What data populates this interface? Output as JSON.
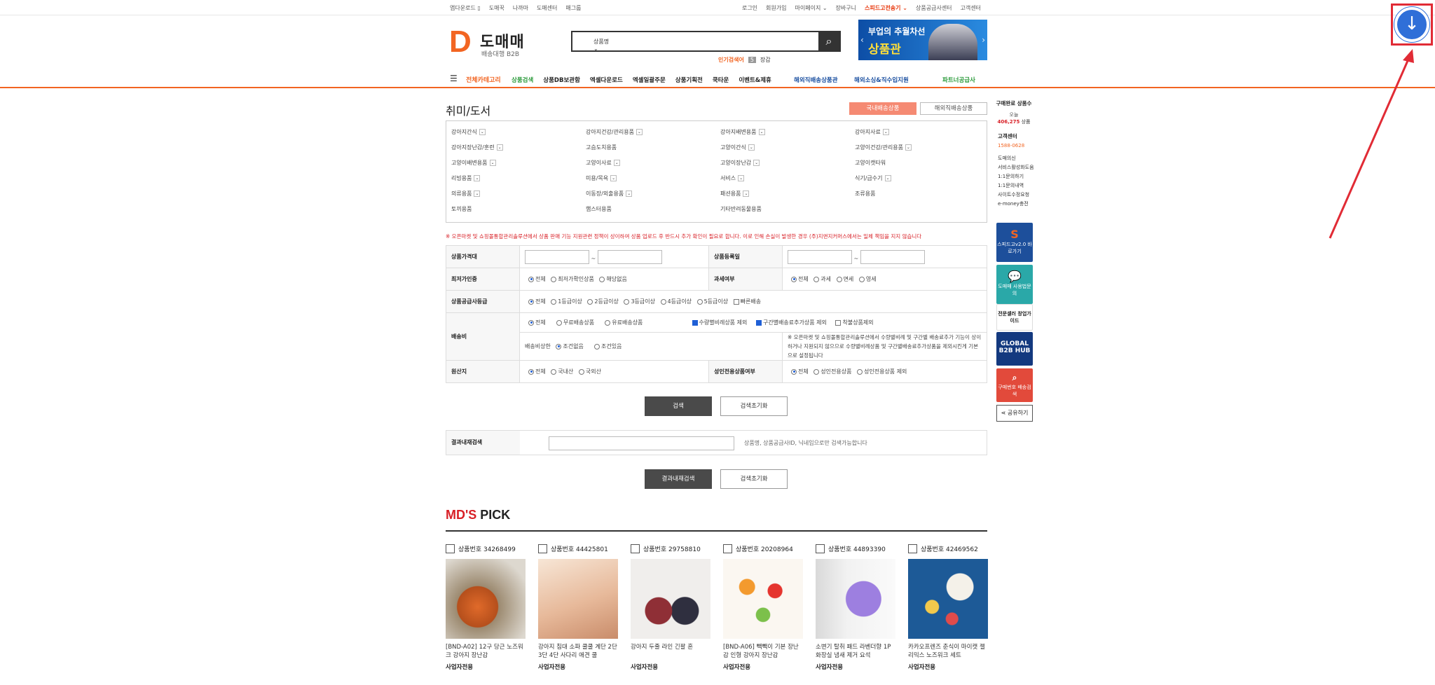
{
  "util_left": [
    "앱다운로드 ▯",
    "도매꾹",
    "나까마",
    "도매센터",
    "매그룹"
  ],
  "util_right": [
    "로그인",
    "회원가입",
    "마이페이지 ⌄",
    "장바구니",
    "스피드고전송기 ⌄",
    "상품공급사센터",
    "고객센터"
  ],
  "logo": {
    "mark": "D",
    "name": "도매매",
    "sub": "배송대행 B2B"
  },
  "search": {
    "category": "상품명",
    "placeholder": ""
  },
  "popular": {
    "label": "인기검색어",
    "rank": "5",
    "term": "장갑"
  },
  "banner": {
    "line1": "부업의 추월차선",
    "line2": "상품관"
  },
  "nav": {
    "all": "전체카테고리",
    "items": [
      "상품검색",
      "상품DB보관함",
      "엑셀다운로드",
      "엑셀일괄주문",
      "상품기획전",
      "쿡타운",
      "이벤트&제휴"
    ],
    "overseas1": "해외직배송상품관",
    "overseas2": "해외소싱&직수입지원",
    "partner": "파트너공급사"
  },
  "page_title": "취미/도서",
  "tabs": {
    "domestic": "국내배송상품",
    "overseas": "해외직배송상품"
  },
  "categories": [
    "강아지간식",
    "강아지건강/관리용품",
    "강아지배변용품",
    "강아지사료",
    "강아지장난감/훈련",
    "고슴도치용품",
    "고양이간식",
    "고양이건강/관리용품",
    "고양이배변용품",
    "고양이사료",
    "고양이장난감",
    "고양이캣타워",
    "리빙용품",
    "미용/목욕",
    "서비스",
    "식기/급수기",
    "의류용품",
    "이동장/외출용품",
    "패션용품",
    "조류용품",
    "토끼용품",
    "햄스터용품",
    "기타반려동물용품",
    ""
  ],
  "notice": "※ 오픈마켓 및 쇼핑몰통합관리솔루션에서 상품 판매 기능 지원관련 정책이 상이하여 상품 업로드 후 반드시 추가 확인이 필요로 합니다. 이로 인해 손실이 발생한 경우 (주)지앤지커머스에서는 일체 책임을 지지 않습니다",
  "filters": {
    "price_label": "상품가격대",
    "reg_label": "상품등록일",
    "minprice_label": "최저가인증",
    "minprice_opts": [
      "전체",
      "최저가확인상품",
      "해당없음"
    ],
    "tax_label": "과세여부",
    "tax_opts": [
      "전체",
      "과세",
      "면세",
      "영세"
    ],
    "grade_label": "상품공급사등급",
    "grade_opts": [
      "전체",
      "1등급이상",
      "2등급이상",
      "3등급이상",
      "4등급이상",
      "5등급이상"
    ],
    "grade_cb": "빠른배송",
    "ship_label": "배송비",
    "ship_opts": [
      "전체",
      "무료배송상품",
      "유료배송상품"
    ],
    "ship_cb1": "수량별비례상품 제외",
    "ship_cb2": "구간별배송료추가상품 제외",
    "ship_cb3": "착불상품제외",
    "ship_cond_label": "배송비상한",
    "ship_cond_opts": [
      "조건없음",
      "조건있음"
    ],
    "ship_note": "※ 오픈마켓 및 쇼핑몰통합관리솔루션에서 수량별비례 및 구간별 배송료추가 기능이 상이하거나 지원되지 않으므로 수량별비례상품 및 구간별배송료추가상품을 제외시킨게 기본으로 설정됩니다",
    "origin_label": "원산지",
    "origin_opts": [
      "전체",
      "국내산",
      "국외산"
    ],
    "adult_label": "성인전용상품여부",
    "adult_opts": [
      "전체",
      "성인전용상품",
      "성인전용상품 제외"
    ]
  },
  "btn_search": "검색",
  "btn_reset": "검색초기화",
  "result": {
    "label": "결과내재검색",
    "hint": "상품명, 상품공급사ID, 닉네임으로만 검색가능합니다",
    "btn": "결과내재검색",
    "reset": "검색초기화"
  },
  "md_title_red": "MD'S",
  "md_title_black": " PICK",
  "products": [
    {
      "no": "상품번호 34268499",
      "title": "[BND-A02] 12구 당근 노즈워크 강아지 장난감",
      "biz": "사업자전용",
      "color": "#7a6a55"
    },
    {
      "no": "상품번호 44425801",
      "title": "강아지 침대 소파 쿨쿨 계단 2단 3단 4단 사다리 애견 쿨",
      "biz": "사업자전용",
      "color": "#e9c9ad"
    },
    {
      "no": "상품번호 29758810",
      "title": "강아지 두줄 라인 긴팔 혼",
      "biz": "사업자전용",
      "color": "#8f3a3a"
    },
    {
      "no": "상품번호 20208964",
      "title": "[BND-A06] 빽빽이 기본 장난감 인형 강아지 장난감",
      "biz": "사업자전용",
      "color": "#f1e6d6"
    },
    {
      "no": "상품번호 44893390",
      "title": "소변기 탈취 패드 라벤더향 1P 화장실 냄새 제거 요석",
      "biz": "사업자전용",
      "color": "#b8a6e0"
    },
    {
      "no": "상품번호 42469562",
      "title": "카카오프렌즈 춘식이 마이캣 젤리믹스 노즈워크 세트",
      "biz": "사업자전용",
      "color": "#1d5a97"
    }
  ],
  "sidebar": {
    "title": "구매완료 상품수",
    "today": "오늘",
    "count": "406,275",
    "count_unit": "상품",
    "cs": "고객센터",
    "tel": "1588-0628",
    "links": [
      "도매의신",
      "서비스활성화도움",
      "1:1문의하기",
      "1:1문의내역",
      "사이트수정요청",
      "e-money충전"
    ],
    "box1": "스피드고v2.0 바로가기",
    "box2": "도매매 사용법문의",
    "box3": "전문셀러 창업가이드",
    "box4": "GLOBAL B2B HUB",
    "box5": "구매번호 배송검색",
    "share": "공유하기"
  }
}
